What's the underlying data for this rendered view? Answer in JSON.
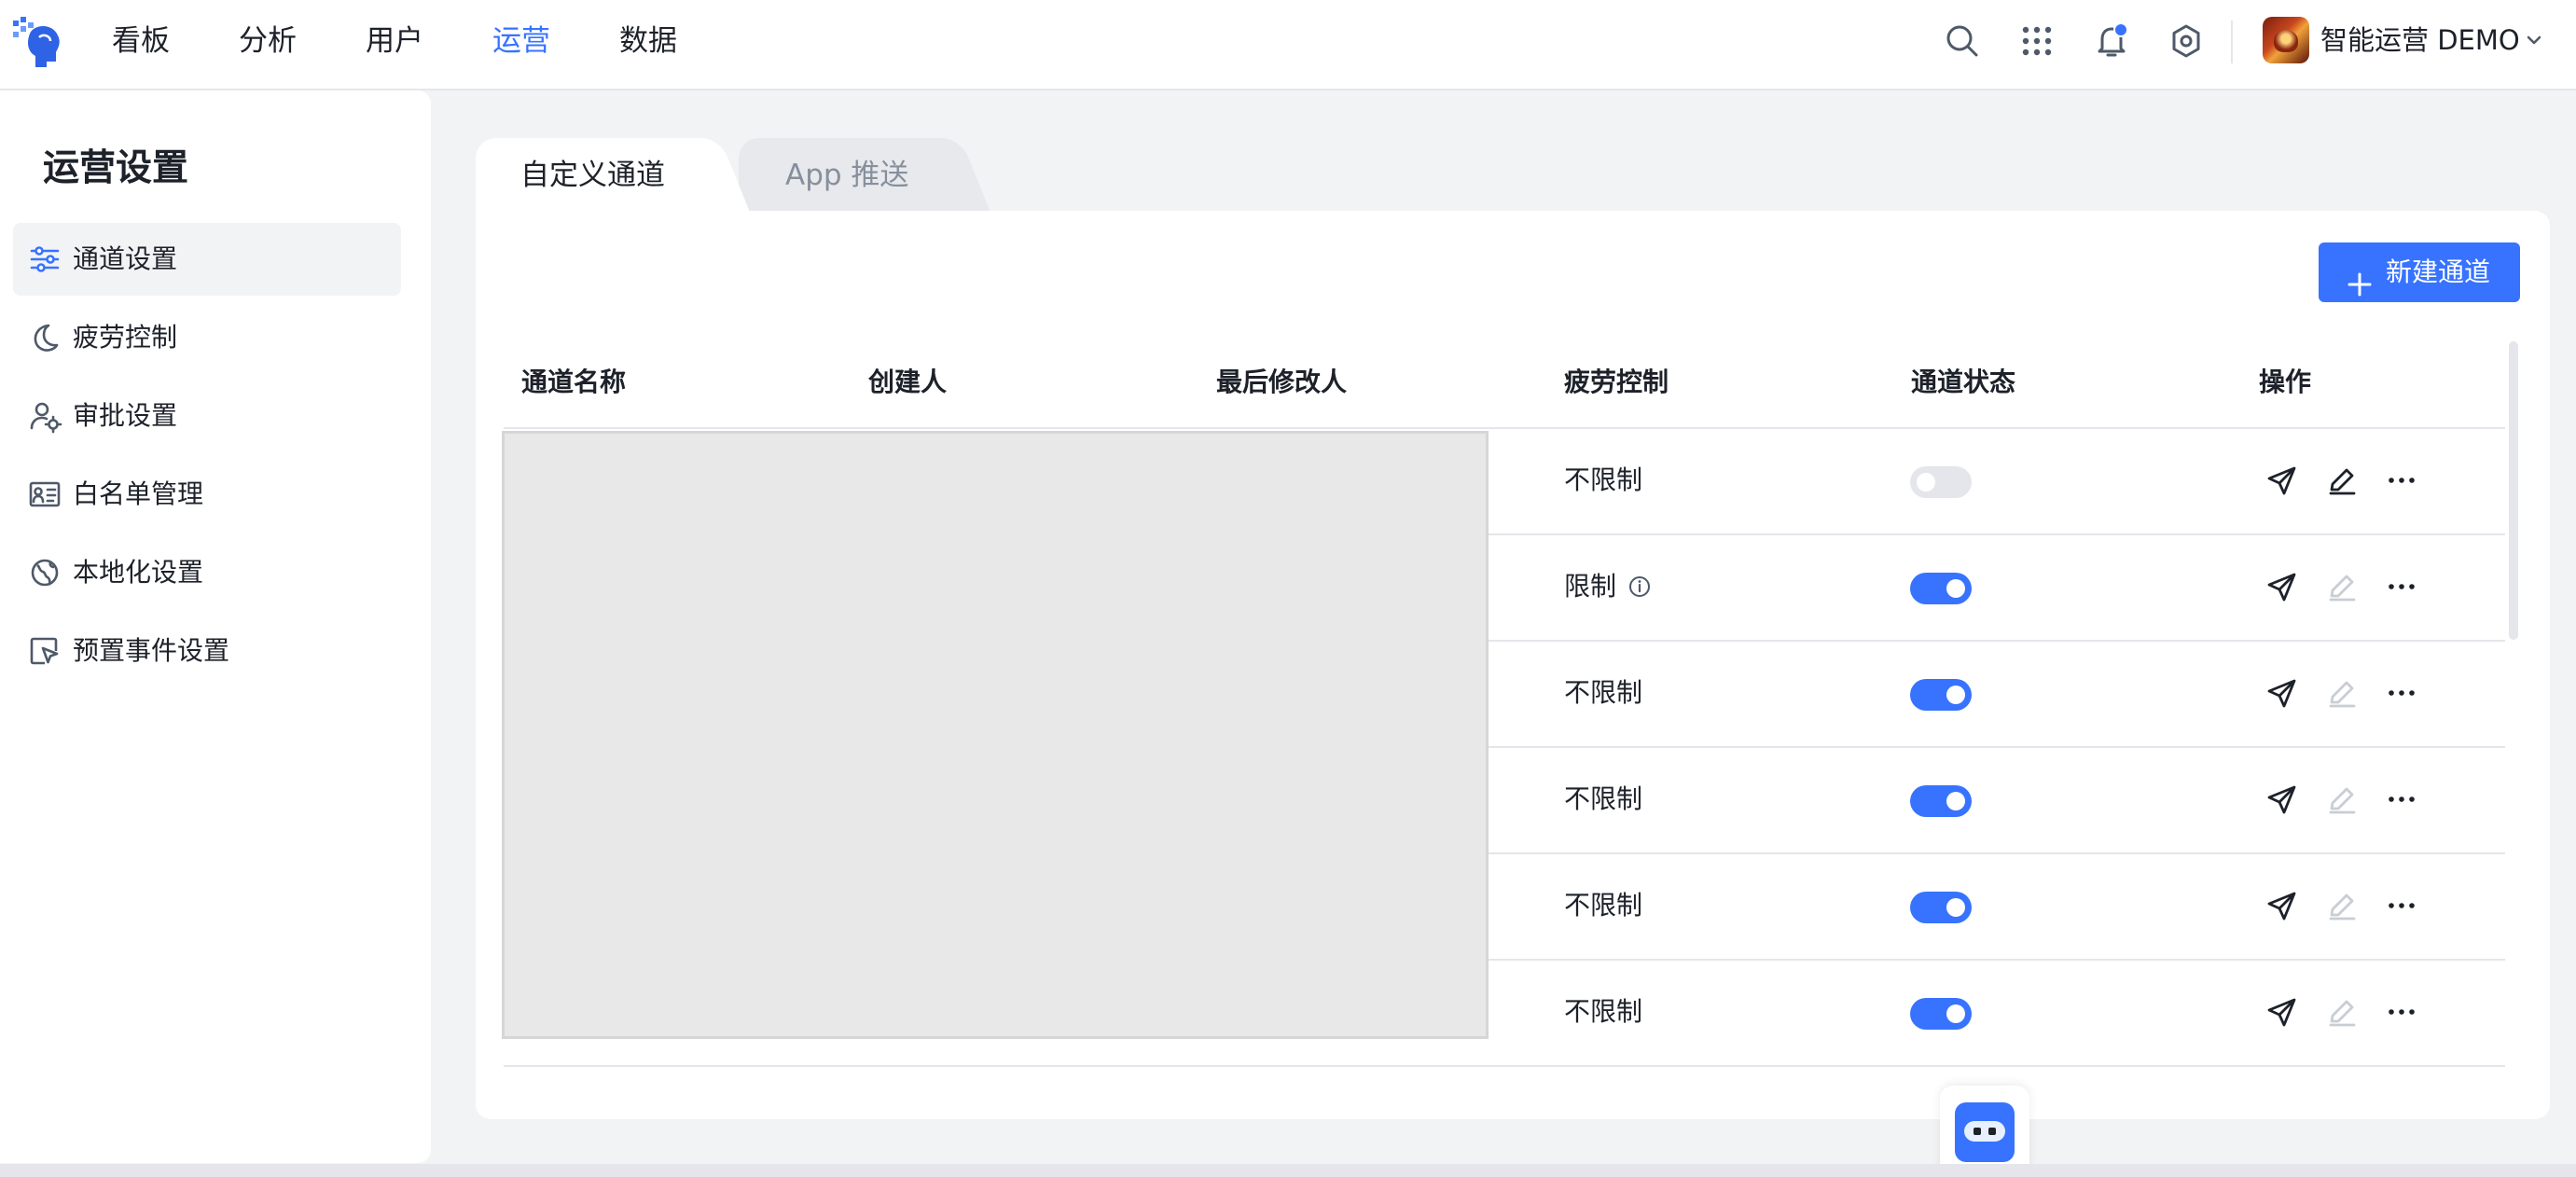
{
  "app": {
    "nav": [
      {
        "label": "看板",
        "active": false
      },
      {
        "label": "分析",
        "active": false
      },
      {
        "label": "用户",
        "active": false
      },
      {
        "label": "运营",
        "active": true
      },
      {
        "label": "数据",
        "active": false
      }
    ],
    "icons": {
      "search": "search-icon",
      "apps": "grid-icon",
      "notifications": "bell-icon",
      "settings": "gear-icon"
    },
    "user": {
      "name": "智能运营 DEMO"
    },
    "accent_color": "#3773ff"
  },
  "sidebar": {
    "title": "运营设置",
    "items": [
      {
        "label": "通道设置",
        "icon": "sliders-icon",
        "active": true
      },
      {
        "label": "疲劳控制",
        "icon": "moon-icon",
        "active": false
      },
      {
        "label": "审批设置",
        "icon": "user-gear-icon",
        "active": false
      },
      {
        "label": "白名单管理",
        "icon": "contact-card-icon",
        "active": false
      },
      {
        "label": "本地化设置",
        "icon": "globe-icon",
        "active": false
      },
      {
        "label": "预置事件设置",
        "icon": "cursor-box-icon",
        "active": false
      }
    ]
  },
  "main": {
    "tabs": [
      {
        "label": "自定义通道",
        "active": true
      },
      {
        "label": "App 推送",
        "active": false
      }
    ],
    "new_button": "新建通道",
    "table": {
      "columns": [
        "通道名称",
        "创建人",
        "最后修改人",
        "疲劳控制",
        "通道状态",
        "操作"
      ],
      "rows": [
        {
          "fatigue": "不限制",
          "fatigue_info": false,
          "enabled": false,
          "edit_enabled": true
        },
        {
          "fatigue": "限制",
          "fatigue_info": true,
          "enabled": true,
          "edit_enabled": false
        },
        {
          "fatigue": "不限制",
          "fatigue_info": false,
          "enabled": true,
          "edit_enabled": false
        },
        {
          "fatigue": "不限制",
          "fatigue_info": false,
          "enabled": true,
          "edit_enabled": false
        },
        {
          "fatigue": "不限制",
          "fatigue_info": false,
          "enabled": true,
          "edit_enabled": false
        },
        {
          "fatigue": "不限制",
          "fatigue_info": false,
          "enabled": true,
          "edit_enabled": false
        }
      ],
      "row_actions": [
        "send-icon",
        "edit-icon",
        "more-icon"
      ]
    }
  }
}
